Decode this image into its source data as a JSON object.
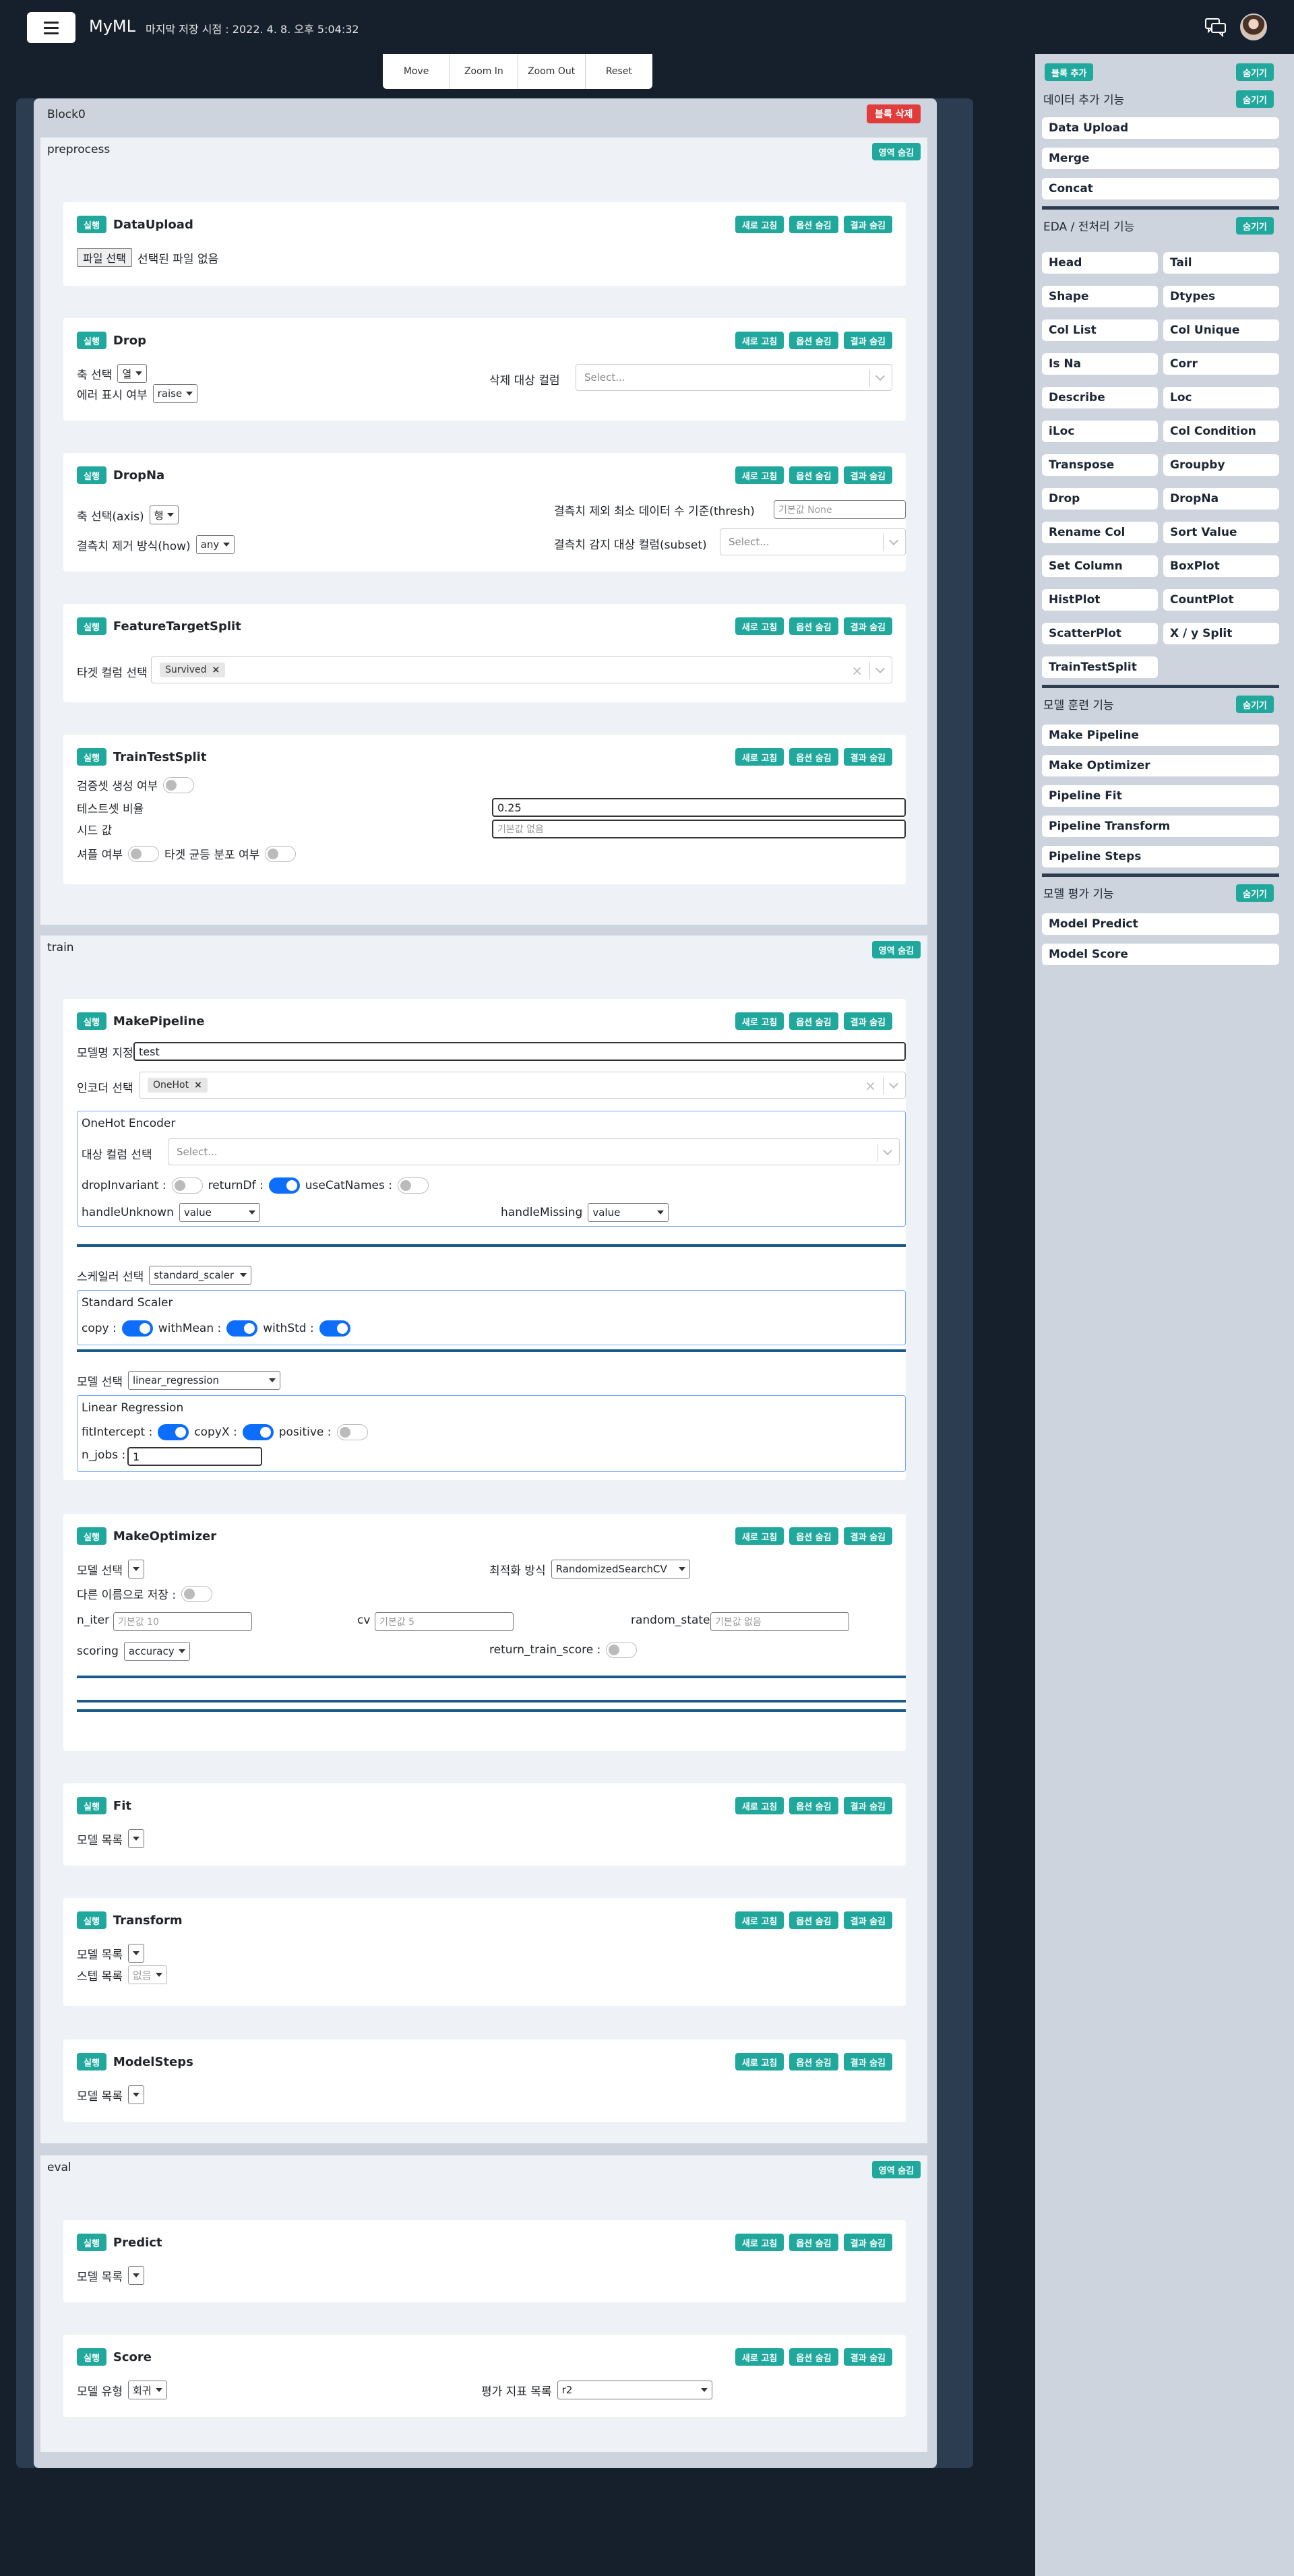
{
  "header": {
    "title": "MyML",
    "last_saved": "마지막 저장 시점 : 2022. 4. 8. 오후 5:04:32"
  },
  "zoom": [
    "Move",
    "Zoom In",
    "Zoom Out",
    "Reset"
  ],
  "block": {
    "name": "Block0",
    "delete_label": "블록 삭제"
  },
  "common": {
    "run": "실행",
    "refresh": "새로 고침",
    "hide_options": "옵션 숨김",
    "hide_result": "결과 숨김",
    "hide_area": "영역 숨김",
    "select_placeholder": "Select...",
    "default_none": "기본값 None",
    "default_unused": "기본값 없음"
  },
  "sections": {
    "preprocess": "preprocess",
    "train": "train",
    "eval": "eval"
  },
  "cards": {
    "upload": {
      "title": "DataUpload",
      "file_btn": "파일 선택",
      "file_status": "선택된 파일 없음"
    },
    "drop": {
      "title": "Drop",
      "axis_label": "축 선택",
      "axis_value": "열",
      "error_label": "에러 표시 여부",
      "error_value": "raise",
      "cols_label": "삭제 대상 컬럼"
    },
    "dropna": {
      "title": "DropNa",
      "axis_label": "축 선택(axis)",
      "axis_value": "행",
      "how_label": "결측치 제거 방식(how)",
      "how_value": "any",
      "thresh_label": "결측치 제외 최소 데이터 수 기준(thresh)",
      "subset_label": "결측치 감지 대상 컬럼(subset)"
    },
    "fts": {
      "title": "FeatureTargetSplit",
      "target_label": "타겟 컬럼 선택",
      "target_chip": "Survived"
    },
    "tts": {
      "title": "TrainTestSplit",
      "val_label": "검증셋 생성 여부",
      "test_label": "테스트셋 비율",
      "test_value": "0.25",
      "seed_label": "시드 값",
      "shuffle_label": "셔플 여부",
      "stratify_label": "타겟 균등 분포 여부"
    },
    "pipeline": {
      "title": "MakePipeline",
      "name_label": "모델명 지정",
      "name_value": "test",
      "encoder_label": "인코더 선택",
      "encoder_chip": "OneHot",
      "onehot_title": "OneHot Encoder",
      "target_cols_label": "대상 컬럼 선택",
      "drop_invariant": "dropInvariant :",
      "return_df": "returnDf :",
      "use_cat_names": "useCatNames :",
      "handle_unknown": "handleUnknown",
      "handle_unknown_value": "value",
      "handle_missing": "handleMissing",
      "handle_missing_value": "value",
      "scaler_label": "스케일러 선택",
      "scaler_value": "standard_scaler",
      "scaler_title": "Standard Scaler",
      "copy": "copy :",
      "with_mean": "withMean :",
      "with_std": "withStd :",
      "model_label": "모델 선택",
      "model_value": "linear_regression",
      "lr_title": "Linear Regression",
      "fit_intercept": "fitIntercept :",
      "copy_x": "copyX :",
      "positive": "positive :",
      "n_jobs": "n_jobs :",
      "n_jobs_value": "1"
    },
    "optimizer": {
      "title": "MakeOptimizer",
      "model_label": "모델 선택",
      "method_label": "최적화 방식",
      "method_value": "RandomizedSearchCV",
      "save_as_label": "다른 이름으로 저장 :",
      "n_iter": "n_iter",
      "n_iter_ph": "기본값 10",
      "cv": "cv",
      "cv_ph": "기본값 5",
      "random_state": "random_state",
      "random_state_ph": "기본값 없음",
      "scoring": "scoring",
      "scoring_value": "accuracy",
      "return_train": "return_train_score :"
    },
    "fit": {
      "title": "Fit",
      "model_list": "모델 목록"
    },
    "transform": {
      "title": "Transform",
      "model_list": "모델 목록",
      "step_list": "스텝 목록",
      "step_value": "없음"
    },
    "model_steps": {
      "title": "ModelSteps",
      "model_list": "모델 목록"
    },
    "predict": {
      "title": "Predict",
      "model_list": "모델 목록"
    },
    "score": {
      "title": "Score",
      "model_type_label": "모델 유형",
      "model_type_value": "회귀",
      "metric_label": "평가 지표 목록",
      "metric_value": "r2"
    }
  },
  "sidebar": {
    "add_block": "블록 추가",
    "hide": "숨기기",
    "data_add_title": "데이터 추가 기능",
    "data_add_items": [
      "Data Upload",
      "Merge",
      "Concat"
    ],
    "eda_title": "EDA / 전처리 기능",
    "eda_items": [
      "Head",
      "Tail",
      "Shape",
      "Dtypes",
      "Col List",
      "Col Unique",
      "Is Na",
      "Corr",
      "Describe",
      "Loc",
      "iLoc",
      "Col Condition",
      "Transpose",
      "Groupby",
      "Drop",
      "DropNa",
      "Rename Col",
      "Sort Value",
      "Set Column",
      "BoxPlot",
      "HistPlot",
      "CountPlot",
      "ScatterPlot",
      "X / y Split",
      "TrainTestSplit"
    ],
    "train_title": "모델 훈련 기능",
    "train_items": [
      "Make Pipeline",
      "Make Optimizer",
      "Pipeline Fit",
      "Pipeline Transform",
      "Pipeline Steps"
    ],
    "eval_title": "모델 평가 기능",
    "eval_items": [
      "Model Predict",
      "Model Score"
    ]
  }
}
